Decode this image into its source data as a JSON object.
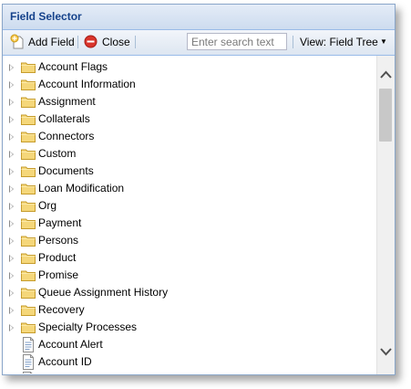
{
  "panel": {
    "title": "Field Selector"
  },
  "toolbar": {
    "add_field_label": "Add Field",
    "close_label": "Close",
    "search_placeholder": "Enter search text",
    "view_label": "View: Field Tree"
  },
  "tree": {
    "folders": [
      "Account Flags",
      "Account Information",
      "Assignment",
      "Collaterals",
      "Connectors",
      "Custom",
      "Documents",
      "Loan Modification",
      "Org",
      "Payment",
      "Persons",
      "Product",
      "Promise",
      "Queue Assignment History",
      "Recovery",
      "Specialty Processes"
    ],
    "fields": [
      "Account Alert",
      "Account ID"
    ]
  },
  "colors": {
    "title": "#15428b",
    "border": "#99bbe8",
    "folder": "#f5d77a",
    "close_icon": "#d9342b"
  },
  "icons": [
    "add-field-icon",
    "close-icon",
    "folder-icon",
    "field-icon",
    "expander-icon",
    "chevron-down-icon"
  ]
}
